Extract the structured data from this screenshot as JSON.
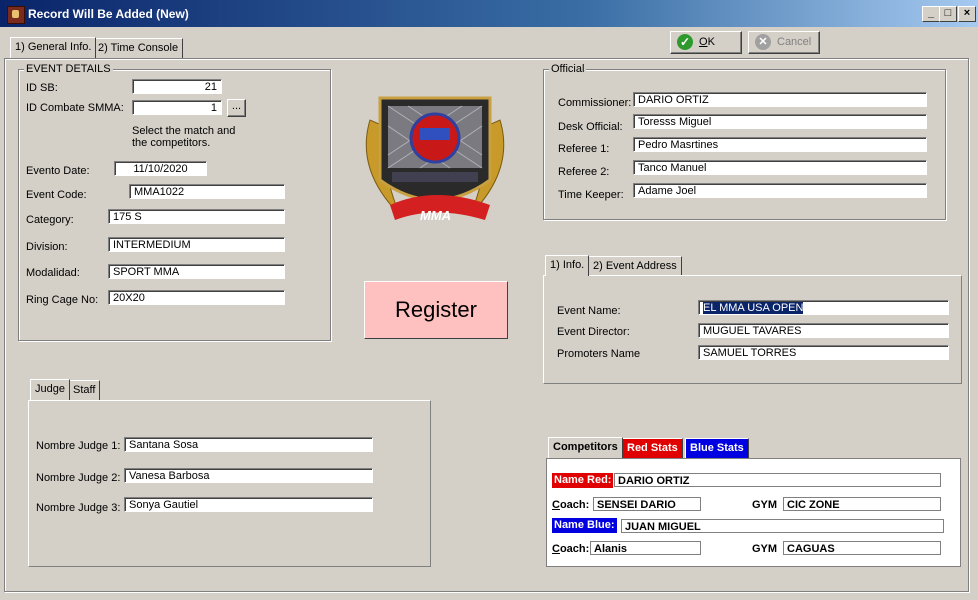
{
  "window": {
    "title": "Record Will Be Added  (New)",
    "minimize": "_",
    "maximize": "□",
    "close": "×"
  },
  "tabs": {
    "general": "1) General Info.",
    "time": "2) Time Console"
  },
  "toolbar": {
    "ok": "OK",
    "cancel": "Cancel"
  },
  "event_details": {
    "legend": "EVENT DETAILS",
    "id_sb_label": "ID SB:",
    "id_sb": "21",
    "id_combate_label": "ID Combate SMMA:",
    "id_combate": "1",
    "browse": "...",
    "hint1": "Select the match and",
    "hint2": "the competitors.",
    "date_label": "Evento Date:",
    "date": "11/10/2020",
    "code_label": "Event Code:",
    "code": "MMA1022",
    "category_label": "Category:",
    "category": "175 S",
    "division_label": "Division:",
    "division": "INTERMEDIUM",
    "modalidad_label": "Modalidad:",
    "modalidad": "SPORT MMA",
    "ring_label": "Ring Cage No:",
    "ring": "20X20"
  },
  "register": "Register",
  "official": {
    "legend": "Official",
    "commissioner_label": "Commissioner:",
    "commissioner": "DARIO ORTIZ",
    "desk_label": "Desk Official:",
    "desk": "Toresss Miguel",
    "ref1_label": "Referee 1:",
    "ref1": "Pedro Masrtines",
    "ref2_label": "Referee 2:",
    "ref2": "Tanco Manuel",
    "tk_label": "Time Keeper:",
    "tk": "Adame Joel"
  },
  "info_tabs": {
    "info": "1) Info.",
    "address": "2) Event Address"
  },
  "info": {
    "name_label": "Event Name:",
    "name": "EL MMA USA OPEN",
    "director_label": "Event Director:",
    "director": "MUGUEL TAVARES",
    "promoters_label": "Promoters Name",
    "promoters": "SAMUEL TORRES"
  },
  "judge_tabs": {
    "judge": "Judge",
    "staff": "Staff"
  },
  "judges": {
    "j1_label": "Nombre Judge 1:",
    "j1": "Santana Sosa",
    "j2_label": "Nombre Judge 2:",
    "j2": "Vanesa Barbosa",
    "j3_label": "Nombre Judge 3:",
    "j3": "Sonya Gautiel"
  },
  "comp_tabs": {
    "competitors": "Competitors",
    "red": "Red Stats",
    "blue": "Blue Stats"
  },
  "competitors": {
    "name_red_label": "Name Red:",
    "name_red": "DARIO ORTIZ",
    "coach_label": "Coach:",
    "coach_red": "SENSEI DARIO",
    "gym_label": "GYM",
    "gym_red": "CIC ZONE",
    "name_blue_label": "Name Blue:",
    "name_blue": "JUAN MIGUEL",
    "coach_blue": "Alanis",
    "gym_blue": "CAGUAS"
  },
  "logo": {
    "text": "MMA"
  },
  "colors": {
    "title_start": "#0a246a",
    "red": "#e00000",
    "blue": "#0000e0",
    "register_bg": "#ffc0c0",
    "face": "#d4d0c8"
  }
}
